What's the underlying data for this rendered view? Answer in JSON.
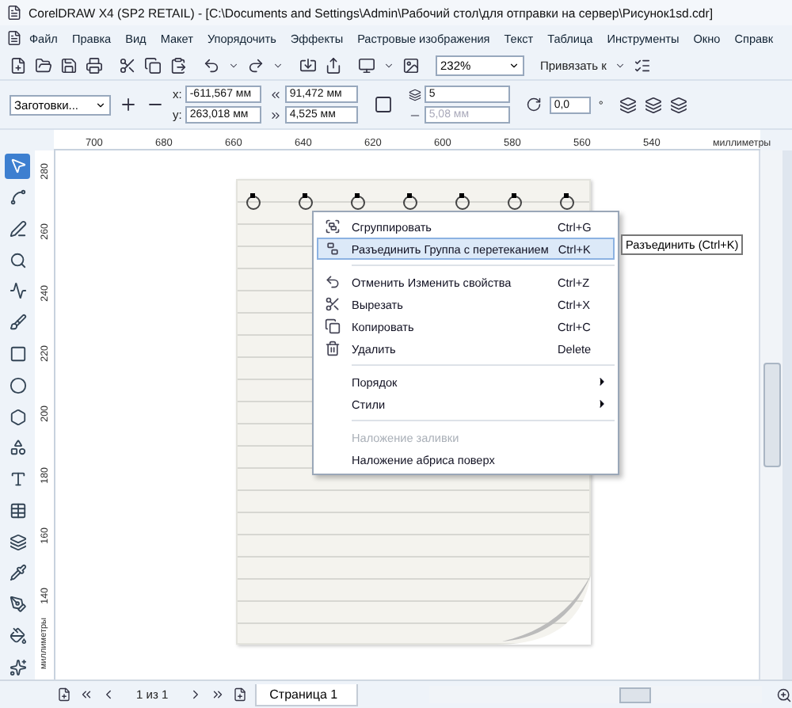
{
  "window": {
    "title": "CorelDRAW X4 (SP2 RETAIL) - [C:\\Documents and Settings\\Admin\\Рабочий стол\\для отправки на сервер\\Рисунок1sd.cdr]"
  },
  "menu": [
    "Файл",
    "Правка",
    "Вид",
    "Макет",
    "Упорядочить",
    "Эффекты",
    "Растровые изображения",
    "Текст",
    "Таблица",
    "Инструменты",
    "Окно",
    "Справк"
  ],
  "toolbar": {
    "zoom": "232%",
    "snap": "Привязать к"
  },
  "property_bar": {
    "preset": "Заготовки...",
    "x_label": "x:",
    "x": "-611,567 мм",
    "y_label": "y:",
    "y": "263,018 мм",
    "width": "91,472 мм",
    "height": "4,525 мм",
    "count": "5",
    "spacing": "5,08 мм",
    "angle": "0,0",
    "degree": "°"
  },
  "ruler": {
    "labels": [
      "700",
      "680",
      "660",
      "640",
      "620",
      "600",
      "580",
      "560",
      "540"
    ],
    "unit": "миллиметры"
  },
  "vertical_ruler": {
    "labels": [
      "280",
      "260",
      "240",
      "220",
      "200",
      "180",
      "160",
      "140"
    ],
    "unit": "миллиметры"
  },
  "context_menu": [
    {
      "kind": "item",
      "label": "Сгруппировать",
      "shortcut": "Ctrl+G",
      "selected": false,
      "disabled": false
    },
    {
      "kind": "item",
      "label": "Разъединить Группа с перетеканием",
      "shortcut": "Ctrl+K",
      "selected": true,
      "disabled": false
    },
    {
      "kind": "separator"
    },
    {
      "kind": "item",
      "label": "Отменить Изменить свойства",
      "shortcut": "Ctrl+Z",
      "selected": false,
      "disabled": false
    },
    {
      "kind": "item",
      "label": "Вырезать",
      "shortcut": "Ctrl+X",
      "selected": false,
      "disabled": false
    },
    {
      "kind": "item",
      "label": "Копировать",
      "shortcut": "Ctrl+C",
      "selected": false,
      "disabled": false
    },
    {
      "kind": "item",
      "label": "Удалить",
      "shortcut": "Delete",
      "selected": false,
      "disabled": false
    },
    {
      "kind": "separator"
    },
    {
      "kind": "submenu",
      "label": "Порядок",
      "selected": false,
      "disabled": false
    },
    {
      "kind": "submenu",
      "label": "Стили",
      "selected": false,
      "disabled": false
    },
    {
      "kind": "separator"
    },
    {
      "kind": "item",
      "label": "Наложение заливки",
      "selected": false,
      "disabled": true
    },
    {
      "kind": "item",
      "label": "Наложение абриса поверх",
      "selected": false,
      "disabled": false
    }
  ],
  "tooltip": "Разъединить (Ctrl+K)",
  "status": {
    "pages": "1 из 1",
    "page_tab": "Страница 1"
  }
}
